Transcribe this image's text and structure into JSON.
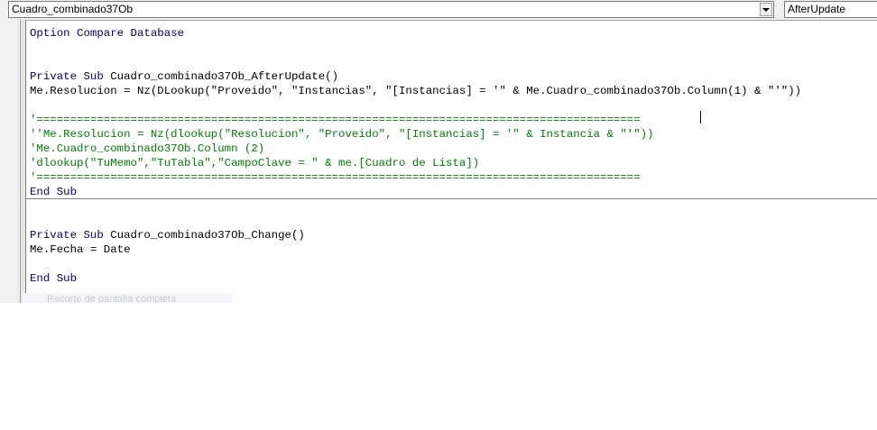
{
  "object_combo": {
    "selected": "Cuadro_combinado37Ob"
  },
  "procedure_combo": {
    "selected": "AfterUpdate"
  },
  "code": {
    "line_option": {
      "kw": "Option Compare Database"
    },
    "sub1_decl": {
      "kw": "Private Sub",
      "name": " Cuadro_combinado37Ob_AfterUpdate()"
    },
    "sub1_body": "Me.Resolucion = Nz(DLookup(\"Proveido\", \"Instancias\", \"[Instancias] = '\" & Me.Cuadro_combinado37Ob.Column(1) & \"'\"))",
    "comment_sep1": "'==========================================================================================",
    "comment_1": "''Me.Resolucion = Nz(dlookup(\"Resolucion\", \"Proveido\", \"[Instancias] = '\" & Instancia & \"'\"))",
    "comment_2": "'Me.Cuadro_combinado37Ob.Column (2)",
    "comment_3": "'dlookup(\"TuMemo\",\"TuTabla\",\"CampoClave = \" & me.[Cuadro de Lista])",
    "comment_sep2": "'==========================================================================================",
    "sub1_end": "End Sub",
    "sub2_decl": {
      "kw": "Private Sub",
      "name": " Cuadro_combinado37Ob_Change()"
    },
    "sub2_body": "Me.Fecha = Date",
    "sub2_end": "End Sub"
  },
  "overlay_text": "Recorte de pantalla completa",
  "colors": {
    "keyword": "#00007f",
    "comment": "#007f00",
    "text": "#000000"
  }
}
